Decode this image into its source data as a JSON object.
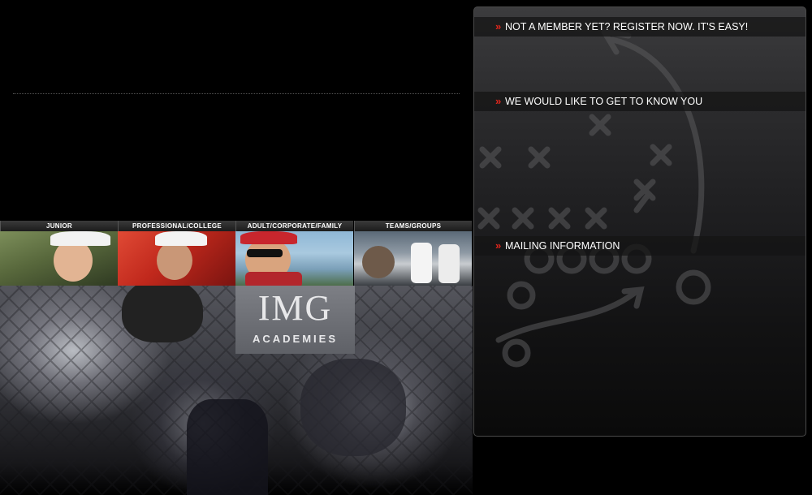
{
  "categories": [
    {
      "label": "JUNIOR"
    },
    {
      "label": "PROFESSIONAL/COLLEGE"
    },
    {
      "label": "ADULT/CORPORATE/FAMILY"
    },
    {
      "label": "TEAMS/GROUPS"
    }
  ],
  "logo": {
    "mark": "IMG",
    "sub": "ACADEMIES"
  },
  "panel": {
    "chevron": "»",
    "sections": [
      {
        "label": "NOT A MEMBER YET? REGISTER NOW. IT'S EASY!"
      },
      {
        "label": "WE WOULD LIKE TO GET TO KNOW YOU"
      },
      {
        "label": "MAILING INFORMATION"
      }
    ]
  },
  "colors": {
    "accent": "#e0261c",
    "background": "#000000",
    "panel_border": "#4a4a4a"
  }
}
